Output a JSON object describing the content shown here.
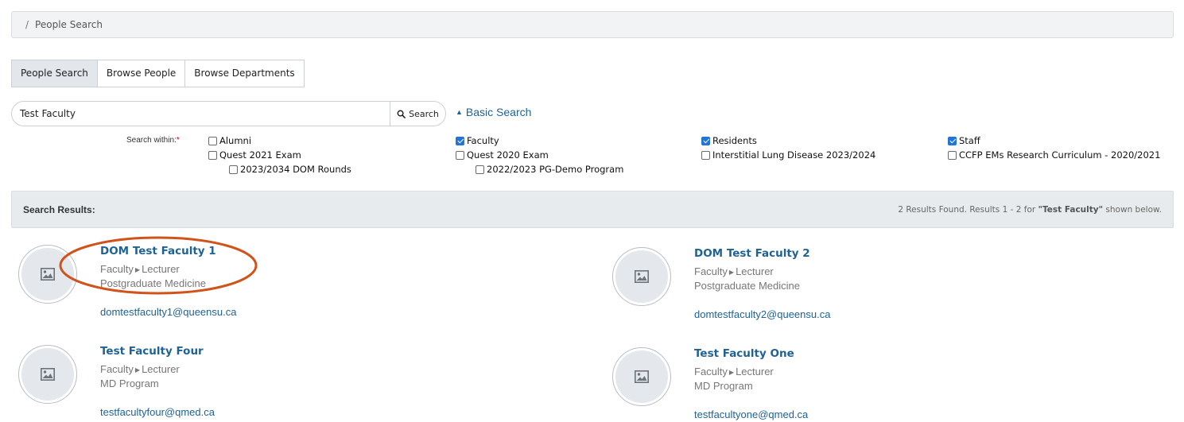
{
  "breadcrumb": {
    "separator": "/",
    "current": "People Search"
  },
  "tabs": [
    {
      "label": "People Search",
      "active": true
    },
    {
      "label": "Browse People",
      "active": false
    },
    {
      "label": "Browse Departments",
      "active": false
    }
  ],
  "search": {
    "value": "Test Faculty",
    "button_label": "Search",
    "basic_search_label": "Basic Search"
  },
  "search_within": {
    "label": "Search within:",
    "required_mark": "*",
    "options": {
      "alumni": {
        "label": "Alumni",
        "checked": false
      },
      "faculty": {
        "label": "Faculty",
        "checked": true
      },
      "residents": {
        "label": "Residents",
        "checked": true
      },
      "staff": {
        "label": "Staff",
        "checked": true
      },
      "quest2021": {
        "label": "Quest 2021 Exam",
        "checked": false
      },
      "quest2020": {
        "label": "Quest 2020 Exam",
        "checked": false
      },
      "ild": {
        "label": "Interstitial Lung Disease 2023/2024",
        "checked": false
      },
      "ccfp": {
        "label": "CCFP EMs Research Curriculum - 2020/2021",
        "checked": false
      },
      "dom_rounds": {
        "label": "2023/2034 DOM Rounds",
        "checked": false
      },
      "pg_demo": {
        "label": "2022/2023 PG-Demo Program",
        "checked": false
      }
    }
  },
  "results": {
    "title": "Search Results:",
    "summary_prefix": "2 Results Found. Results 1 - 2 for ",
    "summary_query": "\"Test Faculty\"",
    "summary_suffix": " shown below.",
    "people": [
      {
        "name": "DOM Test Faculty 1",
        "group": "Faculty",
        "role": "Lecturer",
        "department": "Postgraduate Medicine",
        "email": "domtestfaculty1@queensu.ca"
      },
      {
        "name": "DOM Test Faculty 2",
        "group": "Faculty",
        "role": "Lecturer",
        "department": "Postgraduate Medicine",
        "email": "domtestfaculty2@queensu.ca"
      },
      {
        "name": "Test Faculty Four",
        "group": "Faculty",
        "role": "Lecturer",
        "department": "MD Program",
        "email": "testfacultyfour@qmed.ca"
      },
      {
        "name": "Test Faculty One",
        "group": "Faculty",
        "role": "Lecturer",
        "department": "MD Program",
        "email": "testfacultyone@qmed.ca"
      }
    ]
  },
  "colors": {
    "link": "#1f6294",
    "checkbox_checked": "#2274d8",
    "annotation": "#d0531c"
  }
}
